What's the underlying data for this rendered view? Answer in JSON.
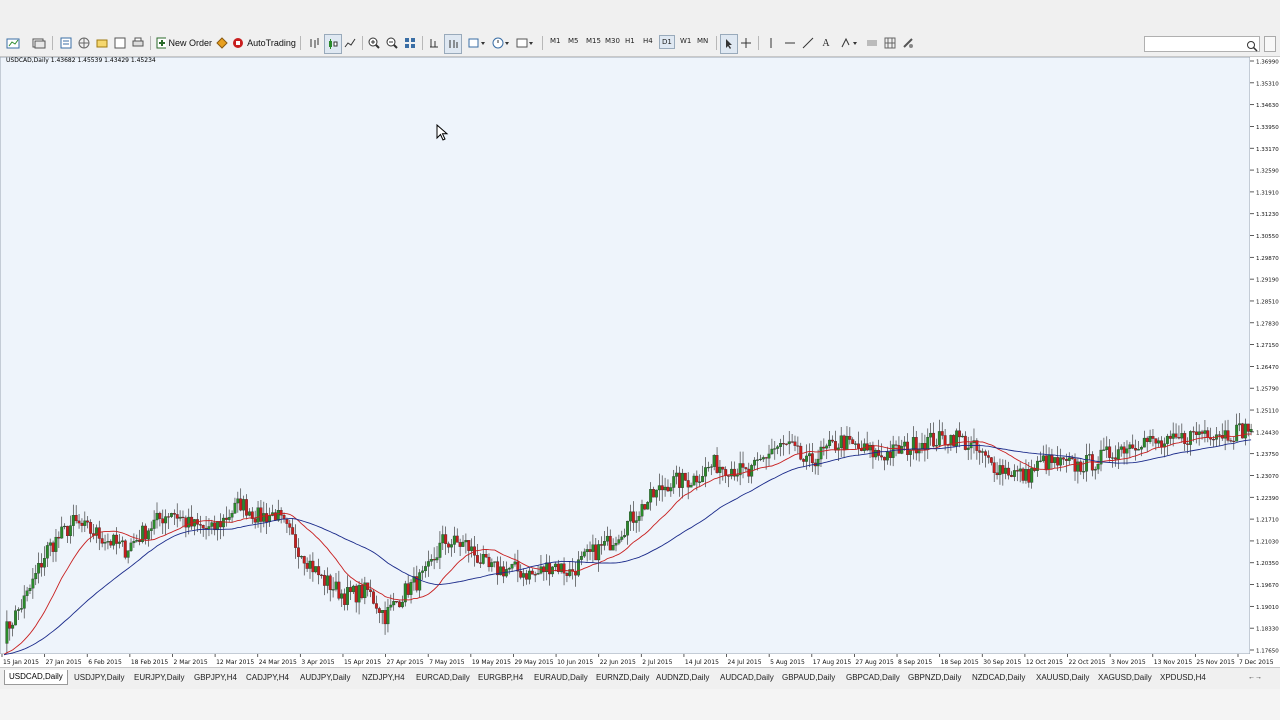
{
  "toolbar": {
    "new_order_label": "New Order",
    "autotrading_label": "AutoTrading",
    "timeframes": [
      "M1",
      "M5",
      "M15",
      "M30",
      "H1",
      "H4",
      "D1",
      "W1",
      "MN"
    ],
    "active_timeframe": "D1"
  },
  "chart_info": {
    "text": "USDCAD,Daily  1.43682 1.45539 1.43429 1.45234"
  },
  "tabs": [
    "USDCAD,Daily",
    "USDJPY,Daily",
    "EURJPY,Daily",
    "GBPJPY,H4",
    "CADJPY,H4",
    "AUDJPY,Daily",
    "NZDJPY,H4",
    "EURCAD,Daily",
    "EURGBP,H4",
    "EURAUD,Daily",
    "EURNZD,Daily",
    "AUDNZD,Daily",
    "AUDCAD,Daily",
    "GBPAUD,Daily",
    "GBPCAD,Daily",
    "GBPNZD,Daily",
    "NZDCAD,Daily",
    "XAUUSD,Daily",
    "XAGUSD,Daily",
    "XPDUSD,H4"
  ],
  "active_tab": "USDCAD,Daily",
  "chart_data": {
    "type": "candlestick",
    "symbol": "USDCAD",
    "timeframe": "Daily",
    "ylim": [
      1.1765,
      1.5633
    ],
    "y_ticks": [
      "1.36990",
      "1.35310",
      "1.34630",
      "1.33950",
      "1.33170",
      "1.32590",
      "1.31910",
      "1.31230",
      "1.30550",
      "1.29870",
      "1.29190",
      "1.28510",
      "1.27830",
      "1.27150",
      "1.26470",
      "1.25790",
      "1.25110",
      "1.24430",
      "1.23750",
      "1.23070",
      "1.22390",
      "1.21710",
      "1.21030",
      "1.20350",
      "1.19670",
      "1.19010",
      "1.18330",
      "1.17650"
    ],
    "x_labels": [
      "15 Jan 2015",
      "27 Jan 2015",
      "6 Feb 2015",
      "18 Feb 2015",
      "2 Mar 2015",
      "12 Mar 2015",
      "24 Mar 2015",
      "3 Apr 2015",
      "15 Apr 2015",
      "27 Apr 2015",
      "7 May 2015",
      "19 May 2015",
      "29 May 2015",
      "10 Jun 2015",
      "22 Jun 2015",
      "2 Jul 2015",
      "14 Jul 2015",
      "24 Jul 2015",
      "5 Aug 2015",
      "17 Aug 2015",
      "27 Aug 2015",
      "8 Sep 2015",
      "18 Sep 2015",
      "30 Sep 2015",
      "12 Oct 2015",
      "22 Oct 2015",
      "3 Nov 2015",
      "13 Nov 2015",
      "25 Nov 2015",
      "7 Dec 2015"
    ],
    "path_points": [
      [
        0,
        1.19
      ],
      [
        8,
        1.215
      ],
      [
        15,
        1.245
      ],
      [
        24,
        1.262
      ],
      [
        32,
        1.255
      ],
      [
        42,
        1.245
      ],
      [
        52,
        1.262
      ],
      [
        58,
        1.27
      ],
      [
        64,
        1.261
      ],
      [
        72,
        1.257
      ],
      [
        82,
        1.275
      ],
      [
        88,
        1.266
      ],
      [
        94,
        1.268
      ],
      [
        102,
        1.246
      ],
      [
        110,
        1.226
      ],
      [
        118,
        1.215
      ],
      [
        126,
        1.218
      ],
      [
        132,
        1.202
      ],
      [
        140,
        1.22
      ],
      [
        146,
        1.228
      ],
      [
        152,
        1.25
      ],
      [
        160,
        1.248
      ],
      [
        168,
        1.232
      ],
      [
        176,
        1.232
      ],
      [
        184,
        1.228
      ],
      [
        190,
        1.236
      ],
      [
        196,
        1.23
      ],
      [
        202,
        1.24
      ],
      [
        210,
        1.25
      ],
      [
        216,
        1.262
      ],
      [
        224,
        1.278
      ],
      [
        230,
        1.288
      ],
      [
        238,
        1.29
      ],
      [
        246,
        1.3
      ],
      [
        252,
        1.298
      ],
      [
        258,
        1.293
      ],
      [
        266,
        1.31
      ],
      [
        272,
        1.312
      ],
      [
        278,
        1.3
      ],
      [
        284,
        1.308
      ],
      [
        290,
        1.315
      ],
      [
        296,
        1.31
      ],
      [
        304,
        1.306
      ],
      [
        312,
        1.31
      ],
      [
        318,
        1.315
      ],
      [
        324,
        1.316
      ],
      [
        330,
        1.318
      ],
      [
        336,
        1.31
      ],
      [
        342,
        1.3
      ],
      [
        348,
        1.296
      ],
      [
        354,
        1.292
      ],
      [
        360,
        1.302
      ],
      [
        366,
        1.3
      ],
      [
        372,
        1.299
      ],
      [
        378,
        1.302
      ],
      [
        386,
        1.31
      ],
      [
        394,
        1.316
      ],
      [
        402,
        1.312
      ],
      [
        410,
        1.318
      ],
      [
        416,
        1.322
      ],
      [
        424,
        1.32
      ],
      [
        432,
        1.324
      ]
    ],
    "ma_red_label": "fast moving average",
    "ma_blue_label": "slow moving average",
    "colors": {
      "bull": "#2a8a2a",
      "bear": "#c81e1e",
      "ma_fast": "#c81e1e",
      "ma_slow": "#1a2a8a",
      "background": "#eef4fb",
      "grid": "#dde6ef"
    }
  }
}
